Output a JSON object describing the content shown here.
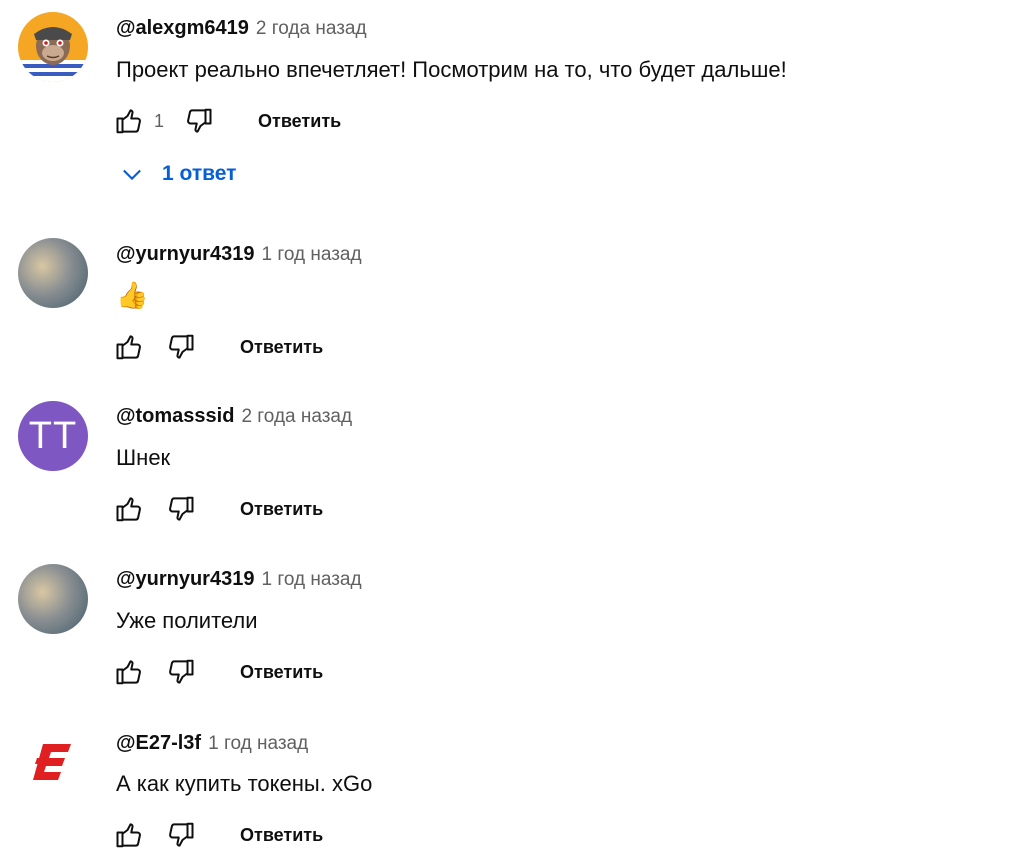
{
  "comments": [
    {
      "author": "@alexgm6419",
      "time": "2 года назад",
      "text": "Проект реально впечетляет! Посмотрим на то, что будет дальше!",
      "likes": "1",
      "reply_label": "Ответить",
      "replies_label": "1 ответ"
    },
    {
      "author": "@yurnyur4319",
      "time": "1 год назад",
      "text": "👍",
      "reply_label": "Ответить"
    },
    {
      "author": "@tomasssid",
      "time": "2 года назад",
      "text": "Шнек",
      "avatar_letters": "ТТ",
      "reply_label": "Ответить"
    },
    {
      "author": "@yurnyur4319",
      "time": "1 год назад",
      "text": "Уже полители",
      "reply_label": "Ответить"
    },
    {
      "author": "@E27-l3f",
      "time": "1 год назад",
      "text": "А как купить токены. xGo",
      "reply_label": "Ответить"
    }
  ],
  "icons": {
    "like": "thumbs-up-icon",
    "dislike": "thumbs-down-icon",
    "expand": "chevron-down-icon"
  },
  "colors": {
    "link": "#065fd4",
    "secondary_text": "#606060",
    "avatar_letter_bg": "#7e57c2",
    "logo_red": "#e02020"
  }
}
